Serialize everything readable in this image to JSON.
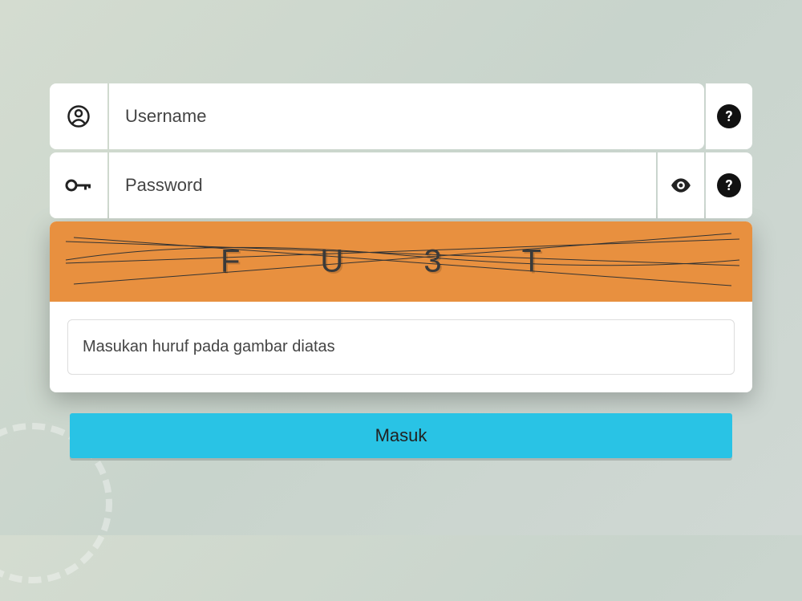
{
  "form": {
    "username": {
      "placeholder": "Username",
      "value": ""
    },
    "password": {
      "placeholder": "Password",
      "value": ""
    },
    "captcha": {
      "text": "FU3T",
      "placeholder": "Masukan huruf pada gambar diatas",
      "value": "",
      "background": "#e8903f"
    },
    "submit_label": "Masuk",
    "help_label": "?"
  },
  "colors": {
    "accent": "#29c3e5"
  }
}
